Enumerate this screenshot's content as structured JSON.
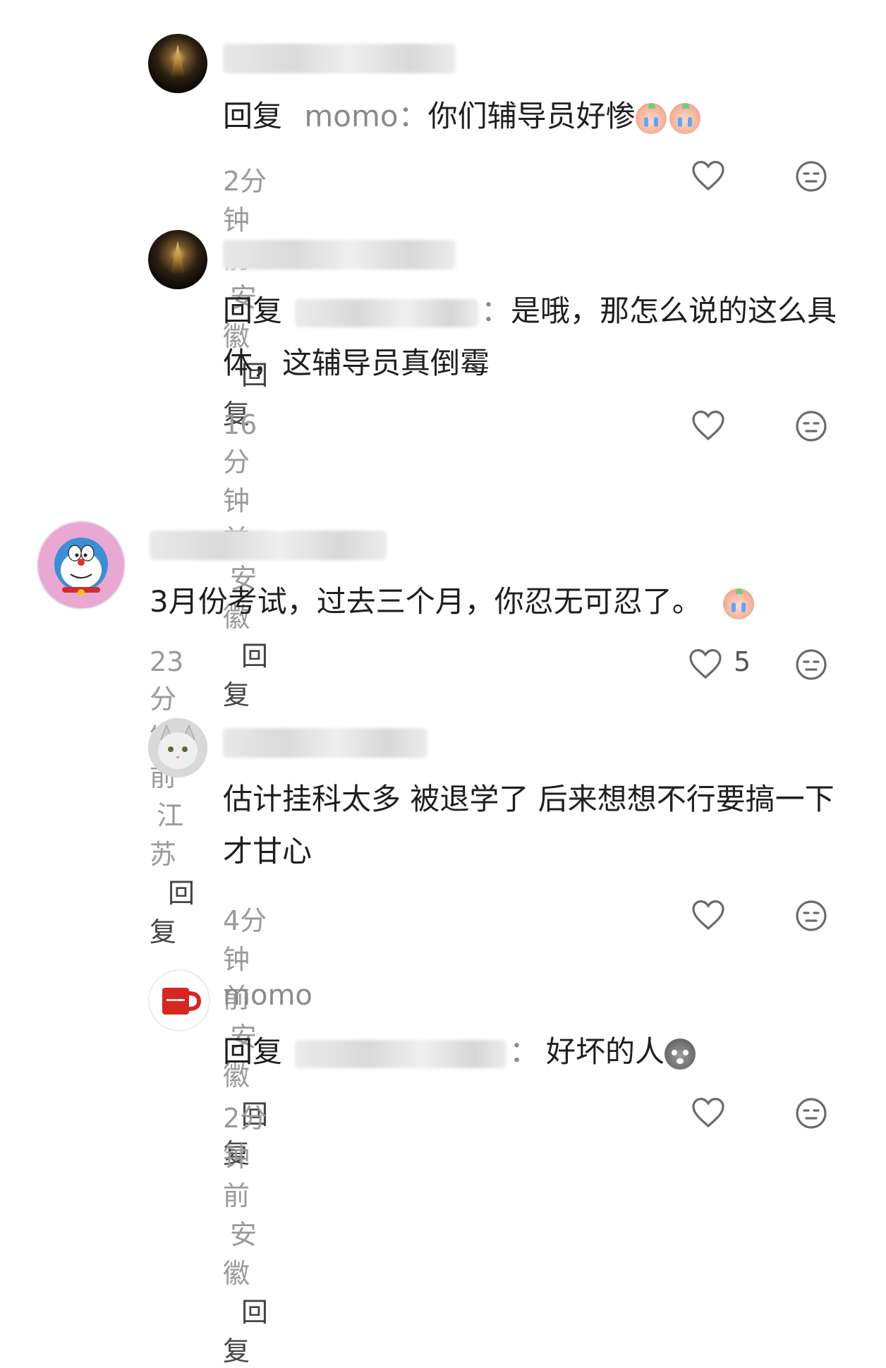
{
  "comments": [
    {
      "reply_keyword": "回复",
      "reply_target": "momo",
      "colon": "：",
      "text": "你们辅导员好惨",
      "time": "2分钟前",
      "location": "安徽",
      "reply_label": "回复"
    },
    {
      "reply_keyword": "回复",
      "colon": "：",
      "text": "是哦，那怎么说的这么具体，这辅导员真倒霉",
      "time": "16分钟前",
      "location": "安徽",
      "reply_label": "回复"
    },
    {
      "text": "3月份考试，过去三个月，你忍无可忍了。",
      "time": "23分钟前",
      "location": "江苏",
      "reply_label": "回复",
      "like_count": "5"
    },
    {
      "text": "估计挂科太多 被退学了 后来想想不行要搞一下才甘心",
      "time": "4分钟前",
      "location": "安徽",
      "reply_label": "回复"
    },
    {
      "username": "momo",
      "reply_keyword": "回复",
      "colon": "：",
      "text": "好坏的人",
      "time": "2分钟前",
      "location": "安徽",
      "reply_label": "回复"
    }
  ],
  "icons": {
    "like": "heart-icon",
    "dislike": "neutral-face-icon",
    "avatar_night": "night-scene-avatar",
    "avatar_doraemon": "doraemon-avatar",
    "avatar_cat": "cat-avatar",
    "avatar_mug": "mug-avatar",
    "emoji_cry": "crying-emoji",
    "emoji_grey": "grey-shocked-emoji"
  },
  "colors": {
    "meta_grey": "#9a9a9a",
    "name_grey": "#8a8a8a",
    "text": "#1f1f1f",
    "icon_grey": "#666666"
  }
}
